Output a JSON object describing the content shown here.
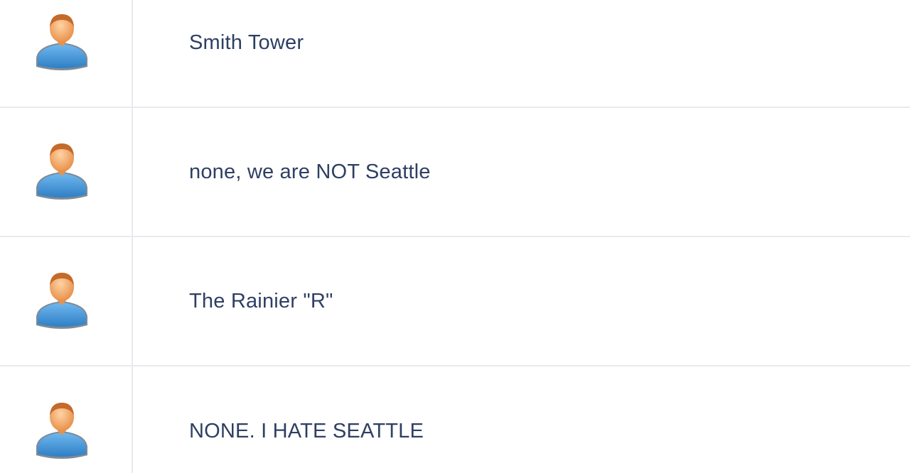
{
  "rows": [
    {
      "avatar_icon": "user-avatar-icon",
      "text": "Smith Tower"
    },
    {
      "avatar_icon": "user-avatar-icon",
      "text": "none, we are NOT Seattle"
    },
    {
      "avatar_icon": "user-avatar-icon",
      "text": "The Rainier \"R\""
    },
    {
      "avatar_icon": "user-avatar-icon",
      "text": "NONE. I HATE SEATTLE"
    }
  ],
  "colors": {
    "text": "#2f3f63",
    "divider": "#e8eaee",
    "avatar_head": "#f2a35e",
    "avatar_hair": "#c46a2a",
    "avatar_body": "#4a9de0"
  }
}
